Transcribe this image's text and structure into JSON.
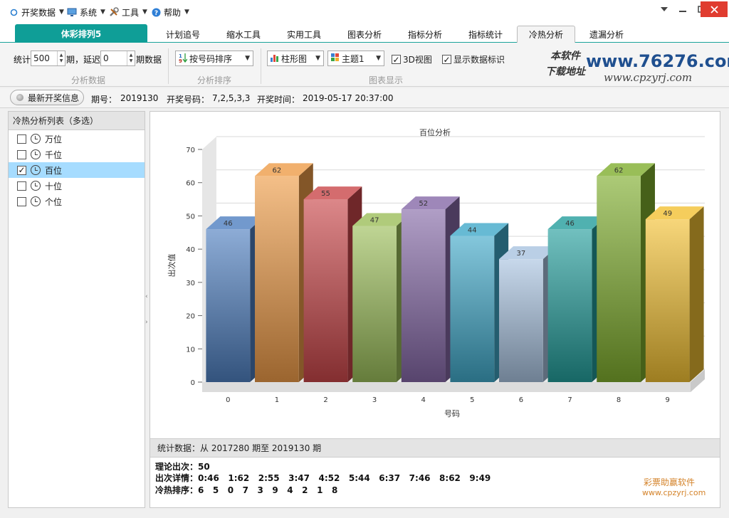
{
  "menu": {
    "items": [
      {
        "label": "开奖数据",
        "icon": "circle-icon"
      },
      {
        "label": "系统",
        "icon": "monitor-icon"
      },
      {
        "label": "工具",
        "icon": "tools-icon"
      },
      {
        "label": "帮助",
        "icon": "help-icon"
      }
    ]
  },
  "tabs": [
    {
      "label": "体彩排列5"
    },
    {
      "label": "计划追号"
    },
    {
      "label": "缩水工具"
    },
    {
      "label": "实用工具"
    },
    {
      "label": "图表分析"
    },
    {
      "label": "指标分析"
    },
    {
      "label": "指标统计"
    },
    {
      "label": "冷热分析"
    },
    {
      "label": "遗漏分析"
    }
  ],
  "active_tab": "冷热分析",
  "ribbon": {
    "stat_label": "统计",
    "period_value": "500",
    "period_label": "期，延迟",
    "delay_value": "0",
    "delay_label": "期数据",
    "group1_label": "分析数据",
    "sort_value": "按号码排序",
    "group2_label": "分析排序",
    "chart_type": "柱形图",
    "theme": "主题1",
    "view3d_label": "3D视图",
    "view3d_checked": true,
    "show_labels_label": "显示数据标识",
    "show_labels_checked": true,
    "group3_label": "图表显示"
  },
  "watermark": {
    "line1": "本软件",
    "line2": "下载地址",
    "site1": "www.76276.com",
    "site2": "www.cpzyrj.com"
  },
  "infobar": {
    "latest_label": "最新开奖信息",
    "issue_label": "期号：",
    "issue_value": "2019130",
    "numbers_label": "开奖号码：",
    "numbers_value": "7,2,5,3,3",
    "time_label": "开奖时间：",
    "time_value": "2019-05-17 20:37:00"
  },
  "left_panel": {
    "title": "冷热分析列表（多选）",
    "items": [
      {
        "label": "万位",
        "checked": false
      },
      {
        "label": "千位",
        "checked": false
      },
      {
        "label": "百位",
        "checked": true
      },
      {
        "label": "十位",
        "checked": false
      },
      {
        "label": "个位",
        "checked": false
      }
    ]
  },
  "chart_data": {
    "type": "bar",
    "title": "百位分析",
    "xlabel": "号码",
    "ylabel": "出次值",
    "categories": [
      "0",
      "1",
      "2",
      "3",
      "4",
      "5",
      "6",
      "7",
      "8",
      "9"
    ],
    "values": [
      46,
      62,
      55,
      47,
      52,
      44,
      37,
      46,
      62,
      49
    ],
    "ylim": [
      0,
      70
    ],
    "yticks": [
      0,
      10,
      20,
      30,
      40,
      50,
      60,
      70
    ],
    "grid": true,
    "view3d": true,
    "colors": [
      "#4f7fc0",
      "#ee9c48",
      "#c9474a",
      "#9cbe5a",
      "#8669a8",
      "#41a9c9",
      "#a9c3e0",
      "#249e9c",
      "#7fae2e",
      "#f2c033"
    ]
  },
  "stats": {
    "header": "统计数据：从 2017280 期至 2019130 期",
    "theory": "理论出次：50",
    "details": "出次详情：0:46   1:62   2:55   3:47   4:52   5:44   6:37   7:46   8:62   9:49",
    "ranking": "冷热排序：6   5   0   7   3   9   4   2   1   8"
  },
  "footer_watermark": {
    "name": "彩票助赢软件",
    "url": "www.cpzyrj.com"
  }
}
